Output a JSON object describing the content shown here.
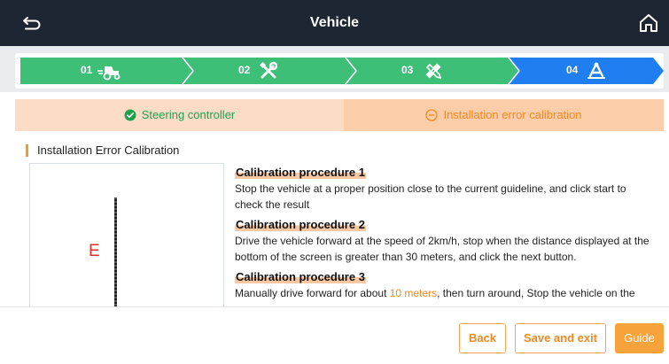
{
  "header": {
    "title": "Vehicle",
    "back_icon": "back-icon",
    "home_icon": "home-icon"
  },
  "steps": {
    "items": [
      {
        "number": "01",
        "icon": "tractor-icon",
        "state": "done"
      },
      {
        "number": "02",
        "icon": "tools-icon",
        "state": "done"
      },
      {
        "number": "03",
        "icon": "ruler-pencil-icon",
        "state": "done"
      },
      {
        "number": "04",
        "icon": "calibration-icon",
        "state": "active"
      }
    ],
    "colors": {
      "done": "#3dbf78",
      "active": "#1f7ff0"
    }
  },
  "tabs": {
    "steering": {
      "label": "Steering controller",
      "status": "complete",
      "color": "#22a04f"
    },
    "calibration": {
      "label": "Installation error calibration",
      "status": "in-progress",
      "color": "#f08a24"
    }
  },
  "section": {
    "title": "Installation Error Calibration"
  },
  "preview": {
    "letter": "E"
  },
  "procedures": [
    {
      "title": "Calibration procedure 1",
      "text": "Stop the vehicle at a proper position close to the current guideline, and click start to check the result"
    },
    {
      "title": "Calibration procedure 2",
      "text": "Drive the vehicle forward at the speed of 2km/h, stop when the distance displayed at the bottom of the screen is greater than 30 meters, and click the next button."
    },
    {
      "title": "Calibration procedure 3",
      "text_before": "Manually drive forward for about ",
      "highlight": "10 meters",
      "text_after": ", then turn around, Stop the vehicle on the line"
    }
  ],
  "buttons": {
    "back": "Back",
    "save_exit": "Save and exit",
    "guide": "Guide"
  },
  "colors": {
    "accent": "#f08a24",
    "tab_bg": "#fcdcc4",
    "topbar": "#1f2633"
  }
}
